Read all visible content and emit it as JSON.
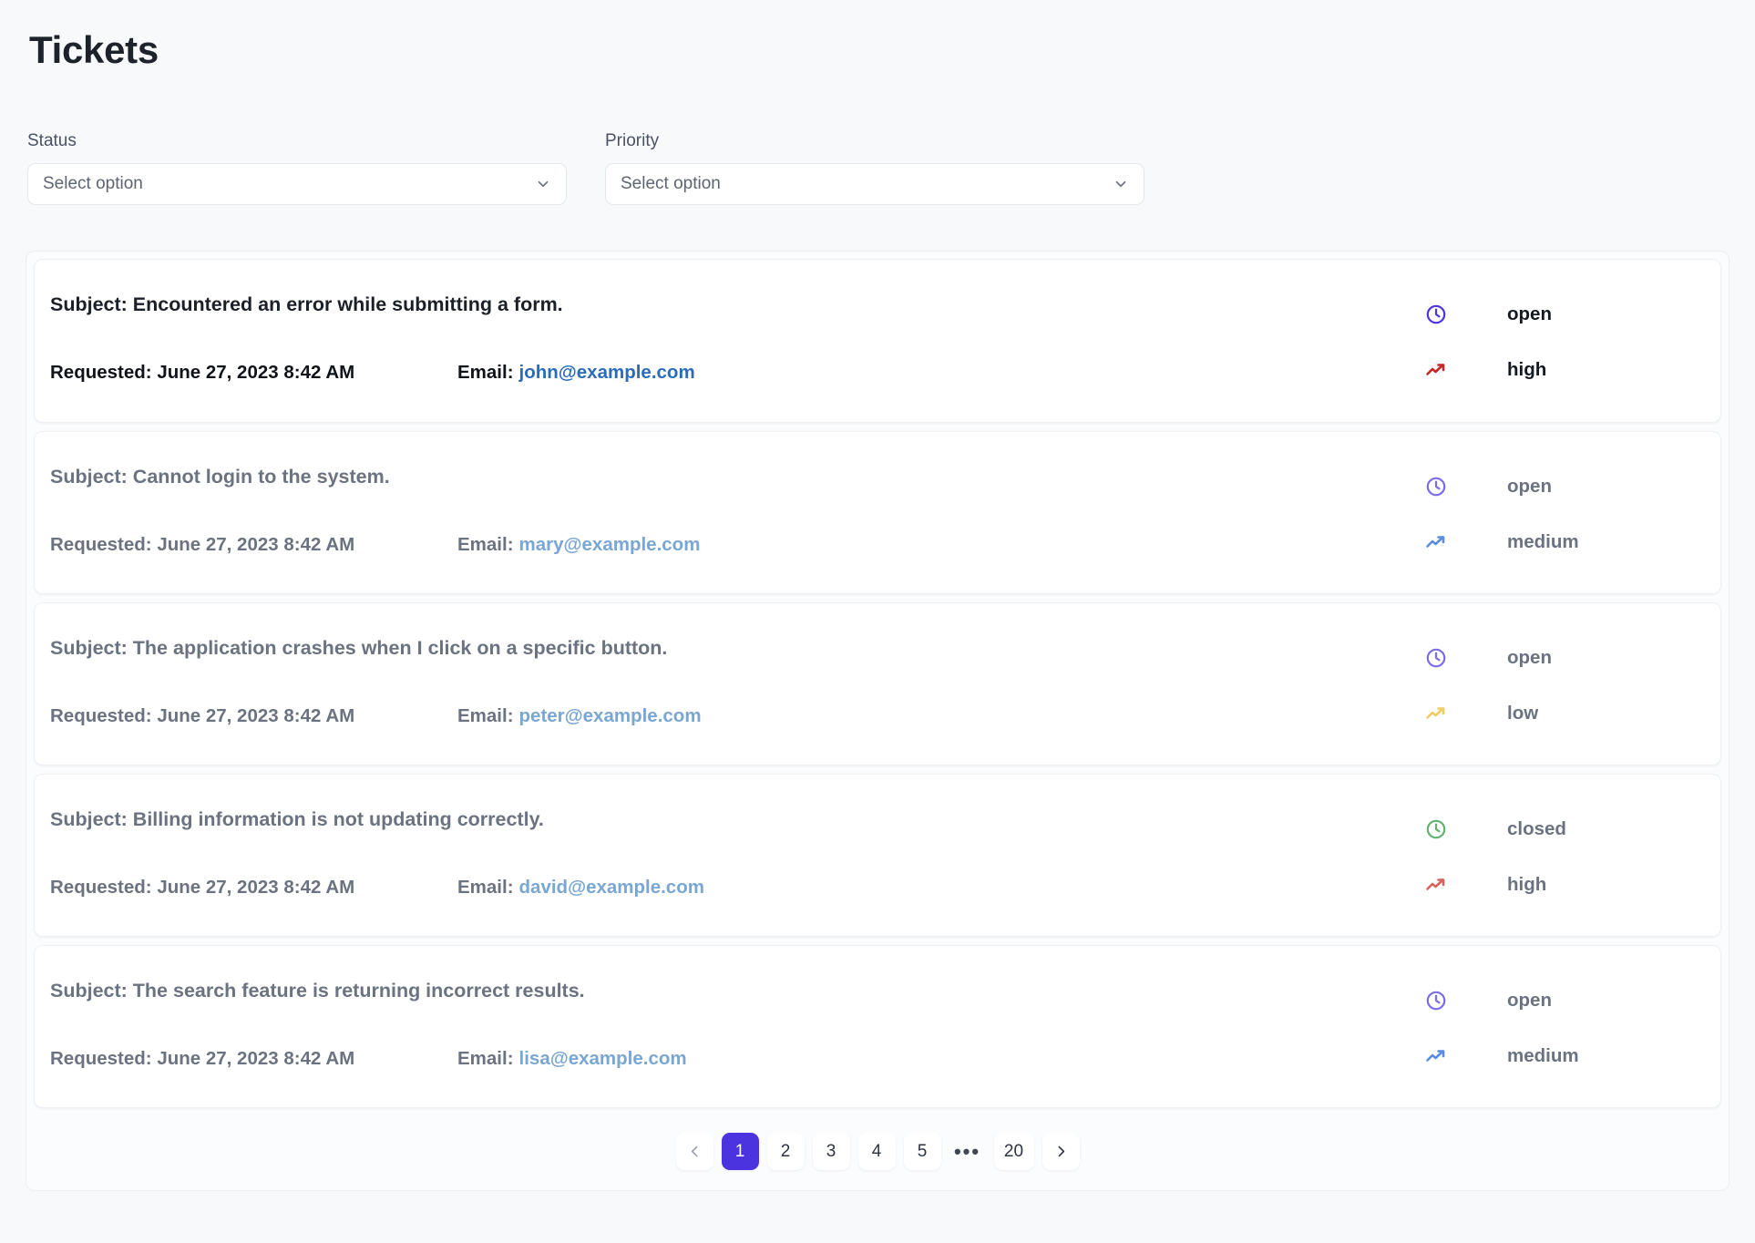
{
  "page": {
    "title": "Tickets",
    "accent_color": "#4b34e0",
    "background_color": "#f7f9fb"
  },
  "filters": [
    {
      "label": "Status",
      "placeholder": "Select option",
      "value": "Select option",
      "caret_icon": "chevron-down-icon"
    },
    {
      "label": "Priority",
      "placeholder": "Select option",
      "value": "Select option",
      "caret_icon": "chevron-down-icon"
    }
  ],
  "tickets": [
    {
      "subject": "Subject: Encountered an error while submitting a form.",
      "requested": "Requested: June 27, 2023 8:42 AM",
      "email_label": "Email:",
      "email": "john@example.com",
      "status": "open",
      "status_icon": "clock-icon",
      "status_color": "#4b34e0",
      "priority": "high",
      "priority_icon": "trending-up-icon",
      "priority_color": "#c62828"
    },
    {
      "subject": "Subject: Cannot login to the system.",
      "requested": "Requested: June 27, 2023 8:42 AM",
      "email_label": "Email:",
      "email": "mary@example.com",
      "status": "open",
      "status_icon": "clock-icon",
      "status_color": "#7c6ce8",
      "priority": "medium",
      "priority_icon": "trending-up-icon",
      "priority_color": "#5b8ee0"
    },
    {
      "subject": "Subject: The application crashes when I click on a specific button.",
      "requested": "Requested: June 27, 2023 8:42 AM",
      "email_label": "Email:",
      "email": "peter@example.com",
      "status": "open",
      "status_icon": "clock-icon",
      "status_color": "#7c6ce8",
      "priority": "low",
      "priority_icon": "trending-up-icon",
      "priority_color": "#f2cc63"
    },
    {
      "subject": "Subject: Billing information is not updating correctly.",
      "requested": "Requested: June 27, 2023 8:42 AM",
      "email_label": "Email:",
      "email": "david@example.com",
      "status": "closed",
      "status_icon": "clock-icon",
      "status_color": "#5fb370",
      "priority": "high",
      "priority_icon": "trending-up-icon",
      "priority_color": "#d9635c"
    },
    {
      "subject": "Subject: The search feature is returning incorrect results.",
      "requested": "Requested: June 27, 2023 8:42 AM",
      "email_label": "Email:",
      "email": "lisa@example.com",
      "status": "open",
      "status_icon": "clock-icon",
      "status_color": "#7c6ce8",
      "priority": "medium",
      "priority_icon": "trending-up-icon",
      "priority_color": "#5b8ee0"
    }
  ],
  "pagination": {
    "prev_icon": "chevron-left-icon",
    "next_icon": "chevron-right-icon",
    "ellipsis": "•••",
    "active_page": "1",
    "pages": [
      "1",
      "2",
      "3",
      "4",
      "5"
    ],
    "last_page": "20"
  }
}
